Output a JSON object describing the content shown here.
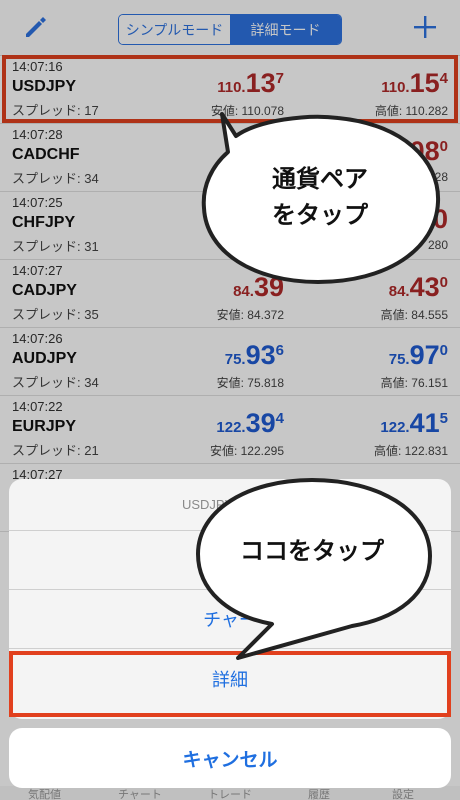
{
  "header": {
    "tabs": [
      {
        "label": "シンプルモード",
        "active": false
      },
      {
        "label": "詳細モード",
        "active": true
      }
    ],
    "left_icon": "pencil-icon",
    "right_icon": "plus-icon"
  },
  "quotes": [
    {
      "time": "14:07:16",
      "symbol": "USDJPY",
      "spread": "スプレッド: 17",
      "bid_prefix": "110.",
      "bid_big": "13",
      "bid_sup": "7",
      "ask_prefix": "110.",
      "ask_big": "15",
      "ask_sup": "4",
      "low": "安値: 110.078",
      "high": "高値: 110.282",
      "color": "red"
    },
    {
      "time": "14:07:28",
      "symbol": "CADCHF",
      "spread": "スプレッド: 34",
      "bid_prefix": "",
      "bid_big": "",
      "bid_sup": "",
      "ask_prefix": "",
      "ask_big": "08",
      "ask_sup": "0",
      "low": "",
      "high": "128",
      "color": "red"
    },
    {
      "time": "14:07:25",
      "symbol": "CHFJPY",
      "spread": "スプレッド: 31",
      "bid_prefix": "",
      "bid_big": "",
      "bid_sup": "",
      "ask_prefix": "",
      "ask_big": "0",
      "ask_sup": "",
      "low": "",
      "high": "280",
      "color": "red"
    },
    {
      "time": "14:07:27",
      "symbol": "CADJPY",
      "spread": "スプレッド: 35",
      "bid_prefix": "84.",
      "bid_big": "39",
      "bid_sup": "",
      "ask_prefix": "84.",
      "ask_big": "43",
      "ask_sup": "0",
      "low": "安値: 84.372",
      "high": "高値: 84.555",
      "color": "red"
    },
    {
      "time": "14:07:26",
      "symbol": "AUDJPY",
      "spread": "スプレッド: 34",
      "bid_prefix": "75.",
      "bid_big": "93",
      "bid_sup": "6",
      "ask_prefix": "75.",
      "ask_big": "97",
      "ask_sup": "0",
      "low": "安値: 75.818",
      "high": "高値: 76.151",
      "color": "blue"
    },
    {
      "time": "14:07:22",
      "symbol": "EURJPY",
      "spread": "スプレッド: 21",
      "bid_prefix": "122.",
      "bid_big": "39",
      "bid_sup": "4",
      "ask_prefix": "122.",
      "ask_big": "41",
      "ask_sup": "5",
      "low": "安値: 122.295",
      "high": "高値: 122.831",
      "color": "blue"
    },
    {
      "time": "14:07:27",
      "symbol": "",
      "spread": "",
      "bid_prefix": "",
      "bid_big": "",
      "bid_sup": "",
      "ask_prefix": "",
      "ask_big": "",
      "ask_sup": "",
      "low": "",
      "high": "",
      "color": "blue"
    }
  ],
  "action_sheet": {
    "title": "USDJPY: US Do",
    "option_hidden": "",
    "option_chart": "チャー",
    "option_detail": "詳細",
    "cancel": "キャンセル"
  },
  "callouts": {
    "top_line1": "通貨ペア",
    "top_line2": "をタップ",
    "bottom": "ココをタップ"
  },
  "tabbar": [
    "気配値",
    "チャート",
    "トレード",
    "履歴",
    "設定"
  ],
  "colors": {
    "accent": "#1f6fe0",
    "highlight": "#e1401e",
    "bid_red": "#b02a2a",
    "bid_blue": "#1f5bd3"
  }
}
